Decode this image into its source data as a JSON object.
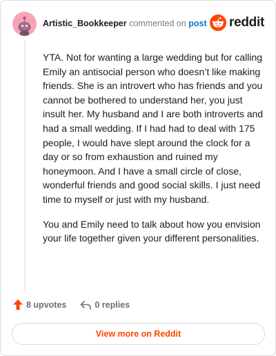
{
  "comment": {
    "username": "Artistic_Bookkeeper",
    "commented_on": "commented on",
    "post_link": "post",
    "brand": "reddit",
    "paragraphs": [
      "YTA. Not for wanting a large wedding but for calling Emily an antisocial person who doesn’t like making friends. She is an introvert who has friends and you cannot be bothered to understand her, you just insult her. My husband and I are both introverts and had a small wedding. If I had had to deal with 175 people, I would have slept around the clock for a day or so from exhaustion and ruined my honeymoon. And I have a small circle of close, wonderful friends and good social skills. I just need time to myself or just with my husband.",
      "You and Emily need to talk about how you envision your life together given your different personalities."
    ],
    "upvotes": "8 upvotes",
    "replies": "0 replies",
    "view_more": "View more on Reddit"
  },
  "colors": {
    "accent": "#ff4500",
    "link": "#0079d3",
    "avatar_bg": "#f6a5b6"
  },
  "icons": {
    "avatar": "snoo-avatar-icon",
    "brand": "reddit-logo-icon",
    "upvote": "upvote-arrow-icon",
    "reply": "reply-arrow-icon"
  }
}
